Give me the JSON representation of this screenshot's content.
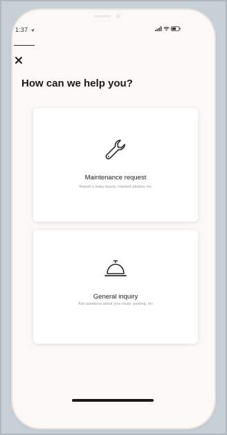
{
  "status_bar": {
    "time": "1:37",
    "icons": [
      "location-arrow-icon",
      "signal-icon",
      "wifi-icon",
      "battery-icon"
    ]
  },
  "header": {
    "close_icon": "close-icon",
    "title": "How can we help you?"
  },
  "options": [
    {
      "icon": "wrench-icon",
      "title": "Maintenance request",
      "subtitle": "Report a leaky faucet, cracked window, etc"
    },
    {
      "icon": "service-bell-icon",
      "title": "General inquiry",
      "subtitle": "Ask questions about your lease, parking, etc"
    }
  ],
  "colors": {
    "background": "#c6d0d6",
    "phone_body": "#fbf8f6",
    "card": "#ffffff",
    "text_primary": "#1a1a1a",
    "text_secondary": "#9a9a9a"
  }
}
